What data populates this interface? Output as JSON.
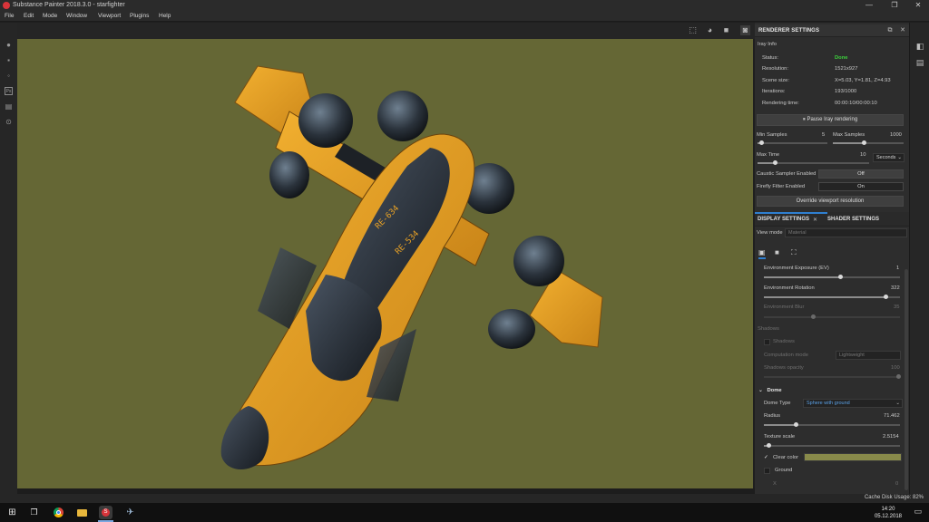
{
  "window": {
    "title": "Substance Painter 2018.3.0 - starfighter",
    "controls": {
      "minimize": "—",
      "maximize": "❐",
      "close": "✕"
    }
  },
  "menu": [
    "File",
    "Edit",
    "Mode",
    "Window",
    "Viewport",
    "Plugins",
    "Help"
  ],
  "renderer": {
    "header": "RENDERER SETTINGS",
    "iray_info_label": "Iray Info",
    "info": [
      {
        "key": "Status:",
        "value": "Done"
      },
      {
        "key": "Resolution:",
        "value": "1521x927"
      },
      {
        "key": "Scene size:",
        "value": "X=5.03, Y=1.81, Z=4.93"
      },
      {
        "key": "Iterations:",
        "value": "193/1000"
      },
      {
        "key": "Rendering time:",
        "value": "00:00:10/00:00:10"
      }
    ],
    "pause_button": "⏸ Pause Iray rendering",
    "min_samples": {
      "label": "Min Samples",
      "value": "5"
    },
    "max_samples": {
      "label": "Max Samples",
      "value": "1000"
    },
    "max_time": {
      "label": "Max Time",
      "value": "10",
      "unit": "Seconds"
    },
    "caustic": {
      "label": "Caustic Sampler Enabled",
      "value": "Off"
    },
    "firefly": {
      "label": "Firefly Filter Enabled",
      "value": "On"
    },
    "override_button": "Override viewport resolution"
  },
  "display": {
    "tabs": [
      "DISPLAY SETTINGS",
      "SHADER SETTINGS"
    ],
    "tab_close": "✕",
    "view_mode_label": "View mode",
    "view_mode_value": "Material",
    "env_exposure": {
      "label": "Environment Exposure (EV)",
      "value": "1"
    },
    "env_rotation": {
      "label": "Environment Rotation",
      "value": "322"
    },
    "env_blur": {
      "label": "Environment Blur",
      "value": "35"
    },
    "shadows_section": "Shadows",
    "shadows_checkbox": "Shadows",
    "computation_mode": {
      "label": "Computation mode",
      "value": "Lightweight"
    },
    "shadows_opacity": {
      "label": "Shadows opacity",
      "value": "100"
    },
    "dome_section": "Dome",
    "dome_type": {
      "label": "Dome Type",
      "value": "Sphere with ground"
    },
    "radius": {
      "label": "Radius",
      "value": "71.462"
    },
    "texture_scale": {
      "label": "Texture scale",
      "value": "2.5154"
    },
    "clear_color": {
      "label": "Clear color",
      "color": "#888a4a"
    },
    "ground": {
      "label": "Ground"
    },
    "x_label": "X",
    "x_value": "0"
  },
  "status": {
    "cache": "Cache Disk Usage:  82%"
  },
  "taskbar": {
    "time": "14:20",
    "date": "05.12.2018"
  },
  "colors": {
    "viewport_bg": "#656735",
    "ship_orange": "#e9a225",
    "status_done": "#3cd13c",
    "accent": "#2f7fd0"
  }
}
